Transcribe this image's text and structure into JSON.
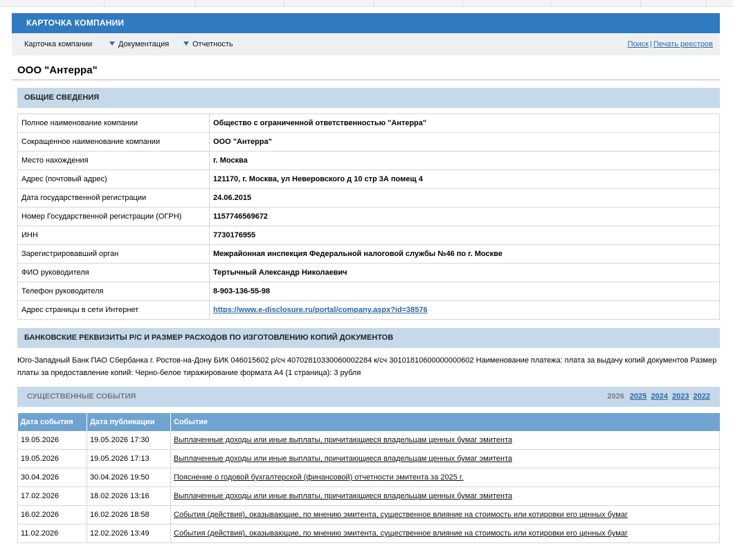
{
  "header": {
    "title": "КАРТОЧКА КОМПАНИИ"
  },
  "menu": {
    "items": [
      "Карточка компании",
      "Документация",
      "Отчетность"
    ],
    "links": [
      "Поиск",
      "Печать реестров"
    ]
  },
  "company": {
    "name": "ООО \"Антерра\""
  },
  "general": {
    "title": "ОБЩИЕ СВЕДЕНИЯ",
    "rows": [
      {
        "label": "Полное наименование компании",
        "value": "Общество с ограниченной ответственностью \"Антерра\""
      },
      {
        "label": "Сокращенное наименование компании",
        "value": "ООО \"Антерра\""
      },
      {
        "label": "Место нахождения",
        "value": "г. Москва"
      },
      {
        "label": "Адрес (почтовый адрес)",
        "value": "121170, г. Москва, ул Неверовского д 10 стр 3А помещ 4"
      },
      {
        "label": "Дата государственной регистрации",
        "value": "24.06.2015"
      },
      {
        "label": "Номер Государственной регистрации (ОГРН)",
        "value": "1157746569672"
      },
      {
        "label": "ИНН",
        "value": "7730176955"
      },
      {
        "label": "Зарегистрировавший орган",
        "value": "Межрайонная инспекция Федеральной налоговой службы №46 по г. Москве"
      },
      {
        "label": "ФИО руководителя",
        "value": "Тертычный Александр Николаевич"
      },
      {
        "label": "Телефон руководителя",
        "value": "8-903-136-55-98"
      },
      {
        "label": "Адрес страницы в сети Интернет",
        "value": "https://www.e-disclosure.ru/portal/company.aspx?id=38576"
      }
    ]
  },
  "bank": {
    "title": "БАНКОВСКИЕ РЕКВИЗИТЫ Р/С И РАЗМЕР РАСХОДОВ ПО ИЗГОТОВЛЕНИЮ КОПИЙ ДОКУМЕНТОВ",
    "text": "Юго-Западный Банк ПАО Сбербанка г. Ростов-на-Дону БИК 046015602 р/сч 40702810330060002284 к/сч 30101810600000000602 Наименование платежа: плата за выдачу копий документов Размер платы за предоставление копий: Черно-белое тиражирование формата А4 (1 страница): 3 рубля"
  },
  "events": {
    "title": "СУЩЕСТВЕННЫЕ СОБЫТИЯ",
    "current_year": "2026",
    "years": [
      "2025",
      "2024",
      "2023",
      "2022"
    ],
    "columns": [
      "Дата события",
      "Дата публикации",
      "Событие"
    ],
    "rows": [
      {
        "date": "19.05.2026",
        "published": "19.05.2026 17:30",
        "event": "Выплаченные доходы или иные выплаты, причитающиеся владельцам ценных бумаг эмитента"
      },
      {
        "date": "19.05.2026",
        "published": "19.05.2026 17:13",
        "event": "Выплаченные доходы или иные выплаты, причитающиеся владельцам ценных бумаг эмитента"
      },
      {
        "date": "30.04.2026",
        "published": "30.04.2026 19:50",
        "event": "Пояснение о годовой бухгалтерской (финансовой) отчетности эмитента за 2025 г."
      },
      {
        "date": "17.02.2026",
        "published": "18.02.2026 13:16",
        "event": "Выплаченные доходы или иные выплаты, причитающиеся владельцам ценных бумаг эмитента"
      },
      {
        "date": "16.02.2026",
        "published": "16.02.2026 18:58",
        "event": "События (действия), оказывающие, по мнению эмитента, существенное влияние на стоимость или котировки его ценных бумаг"
      },
      {
        "date": "11.02.2026",
        "published": "12.02.2026 13:49",
        "event": "События (действия), оказывающие, по мнению эмитента, существенное влияние на стоимость или котировки его ценных бумаг"
      }
    ]
  }
}
